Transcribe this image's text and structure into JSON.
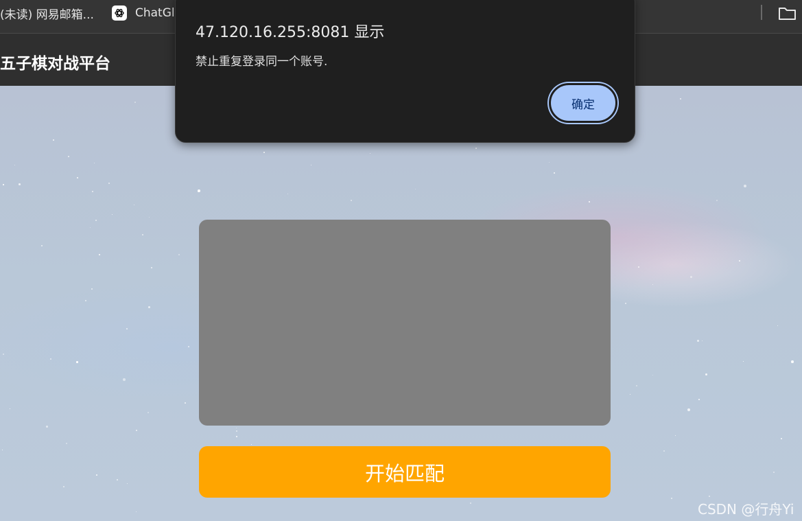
{
  "bookmarks": {
    "items": [
      {
        "label": "(未读) 网易邮箱...",
        "icon": "mail-icon"
      },
      {
        "label": "ChatGl",
        "icon": "chatgpt-icon"
      }
    ],
    "folder_icon": "folder-icon"
  },
  "header": {
    "title": "五子棋对战平台"
  },
  "main": {
    "start_match_label": "开始匹配",
    "card_color": "#808080",
    "button_color": "#ffa500"
  },
  "dialog": {
    "title": "47.120.16.255:8081 显示",
    "message": "禁止重复登录同一个账号.",
    "confirm_label": "确定",
    "accent_color": "#a8c7fa"
  },
  "watermark": {
    "text": "CSDN @行舟Yi"
  }
}
